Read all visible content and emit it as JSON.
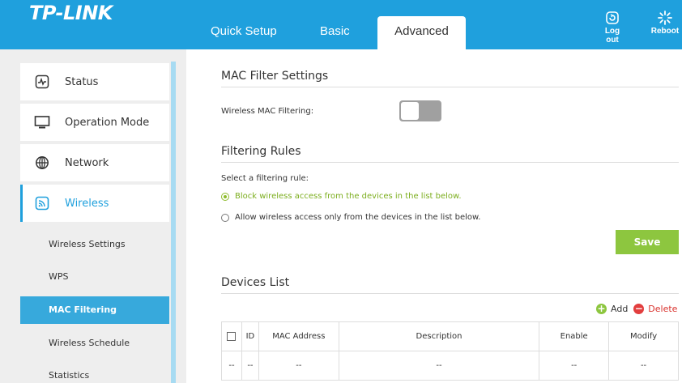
{
  "header": {
    "logo": "TP-LINK",
    "tabs": [
      "Quick Setup",
      "Basic",
      "Advanced"
    ],
    "active_tab": "Advanced",
    "logout_label": "Log out",
    "reboot_label": "Reboot"
  },
  "sidebar": {
    "items": [
      {
        "label": "Status",
        "icon": "status-icon"
      },
      {
        "label": "Operation Mode",
        "icon": "monitor-icon"
      },
      {
        "label": "Network",
        "icon": "globe-icon"
      },
      {
        "label": "Wireless",
        "icon": "wireless-icon",
        "active": true
      }
    ],
    "sub_items": [
      {
        "label": "Wireless Settings"
      },
      {
        "label": "WPS"
      },
      {
        "label": "MAC Filtering",
        "active": true
      },
      {
        "label": "Wireless Schedule"
      },
      {
        "label": "Statistics"
      }
    ]
  },
  "mac_filter": {
    "title": "MAC Filter Settings",
    "toggle_label": "Wireless MAC Filtering:",
    "toggle_on": false
  },
  "rules": {
    "title": "Filtering Rules",
    "prompt": "Select a filtering rule:",
    "options": [
      {
        "label": "Block wireless access from the devices in the list below.",
        "selected": true
      },
      {
        "label": "Allow wireless access only from the devices in the list below.",
        "selected": false
      }
    ],
    "save_label": "Save"
  },
  "devices": {
    "title": "Devices List",
    "add_label": "Add",
    "delete_label": "Delete",
    "columns": [
      "ID",
      "MAC Address",
      "Description",
      "Enable",
      "Modify"
    ],
    "rows": [
      [
        "--",
        "--",
        "--",
        "--",
        "--",
        "--"
      ]
    ]
  },
  "colors": {
    "brand": "#1fa0dd",
    "save": "#8dc63f",
    "selected_rule": "#7cae1e",
    "delete": "#e23e3e"
  }
}
